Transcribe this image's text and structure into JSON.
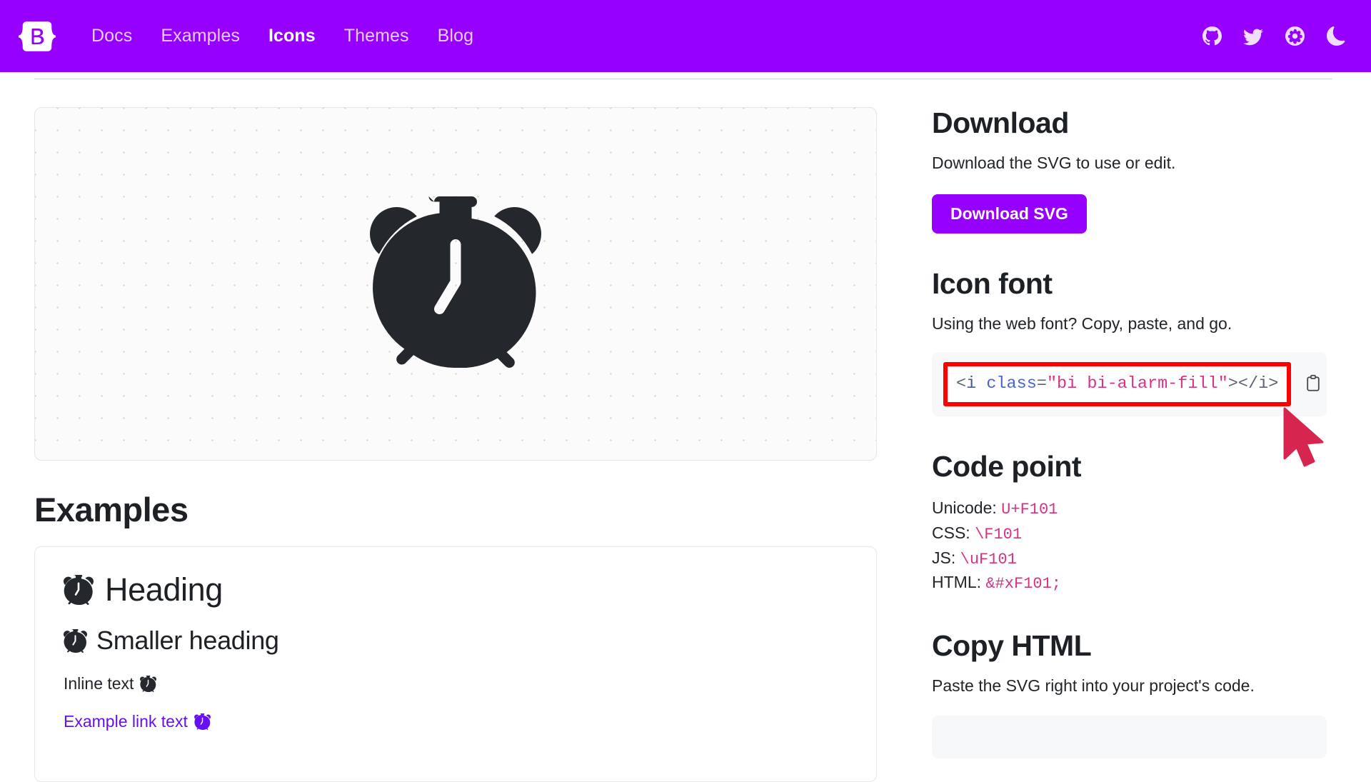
{
  "navbar": {
    "brand_name": "bootstrap-logo",
    "links": [
      {
        "label": "Docs",
        "active": false
      },
      {
        "label": "Examples",
        "active": false
      },
      {
        "label": "Icons",
        "active": true
      },
      {
        "label": "Themes",
        "active": false
      },
      {
        "label": "Blog",
        "active": false
      }
    ],
    "icons": [
      {
        "name": "github-icon"
      },
      {
        "name": "twitter-icon"
      },
      {
        "name": "opencollective-icon"
      },
      {
        "name": "theme-toggle-icon"
      }
    ],
    "background_color": "#9500ff"
  },
  "preview": {
    "icon_name": "alarm-fill-icon",
    "icon_color": "#24272b"
  },
  "examples": {
    "title": "Examples",
    "heading": "Heading",
    "smaller_heading": "Smaller heading",
    "inline_text": "Inline text",
    "link_text": "Example link text",
    "link_color": "#6610f2"
  },
  "download": {
    "title": "Download",
    "description": "Download the SVG to use or edit.",
    "button_label": "Download SVG",
    "button_color": "#9500ff"
  },
  "icon_font": {
    "title": "Icon font",
    "description": "Using the web font? Copy, paste, and go.",
    "snippet": {
      "open_lt": "<",
      "tag": "i",
      "space": " ",
      "attr": "class",
      "equals": "=",
      "value": "\"bi bi-alarm-fill\"",
      "close_gt": ">",
      "closing": "</i>",
      "full": "<i class=\"bi bi-alarm-fill\"></i>"
    },
    "copy_button_name": "copy-to-clipboard",
    "highlight_color": "#ff0000"
  },
  "code_point": {
    "title": "Code point",
    "rows": [
      {
        "label": "Unicode:",
        "value": "U+F101"
      },
      {
        "label": "CSS:",
        "value": "\\F101"
      },
      {
        "label": "JS:",
        "value": "\\uF101"
      },
      {
        "label": "HTML:",
        "value": "&#xF101;"
      }
    ],
    "value_color": "#d63384"
  },
  "copy_html": {
    "title": "Copy HTML",
    "description": "Paste the SVG right into your project's code."
  },
  "cursor": {
    "name": "mouse-cursor",
    "color": "#d6254f"
  }
}
